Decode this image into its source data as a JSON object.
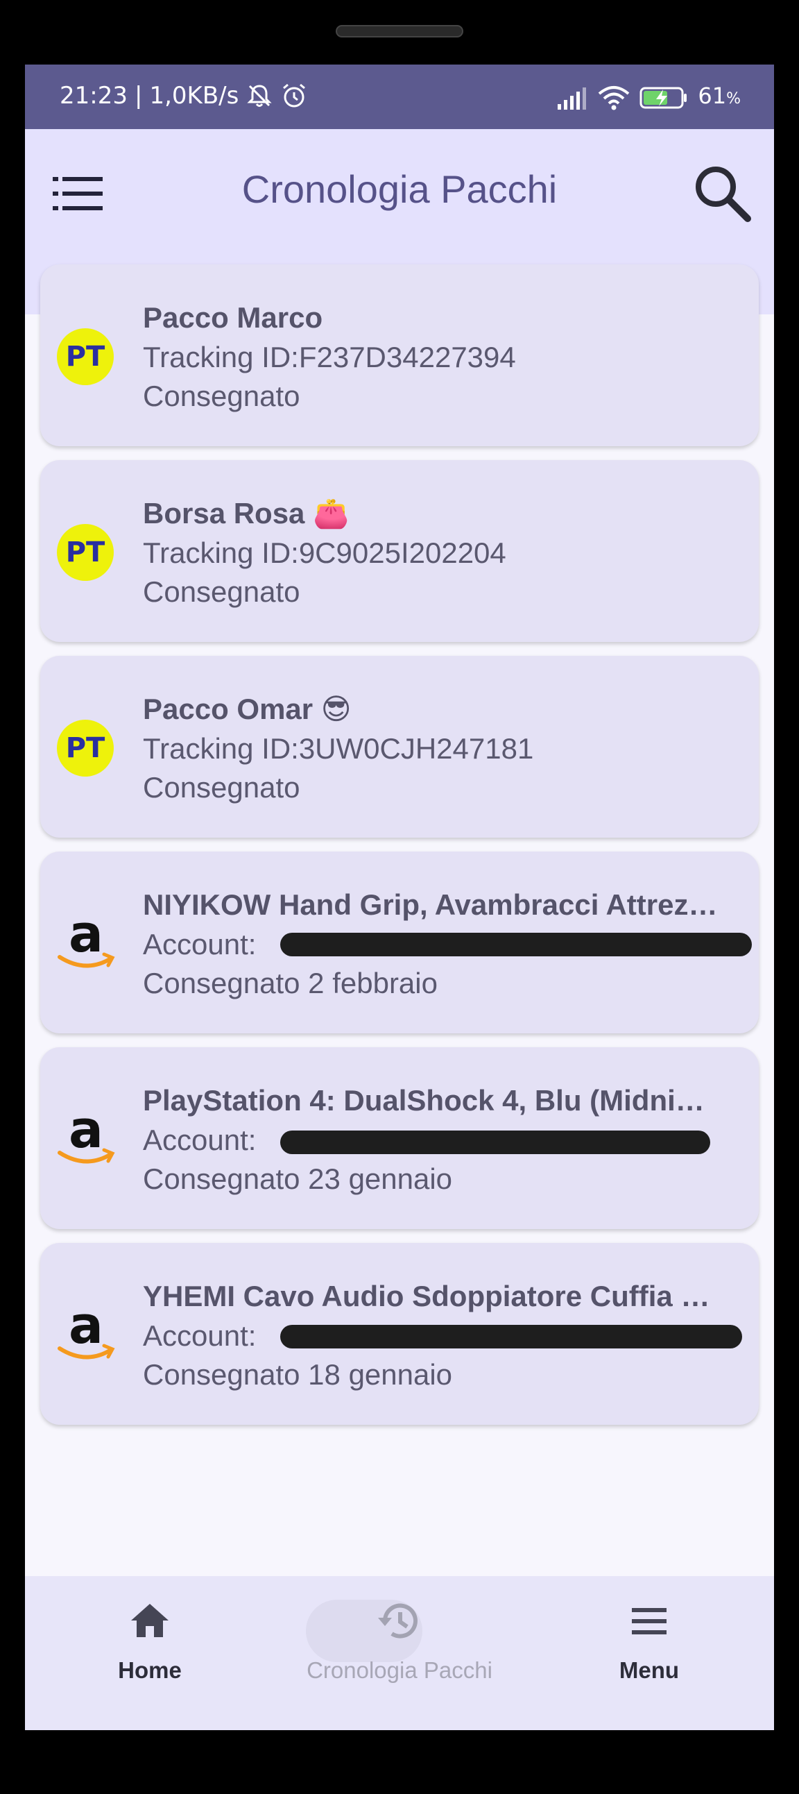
{
  "status_bar": {
    "time": "21:23",
    "separator": "|",
    "speed": "1,0KB/s",
    "battery": "61",
    "battery_unit": "%",
    "icons": [
      "mute-bell-icon",
      "alarm-icon",
      "signal-icon",
      "wifi-icon",
      "battery-charging-icon"
    ]
  },
  "app_bar": {
    "title": "Cronologia Pacchi",
    "menu_icon": "list-menu-icon",
    "search_icon": "search-icon"
  },
  "packages": [
    {
      "carrier": "PT",
      "name": "Pacco Marco",
      "detail": "Tracking ID:F237D34227394",
      "status": "Consegnato"
    },
    {
      "carrier": "PT",
      "name": "Borsa Rosa 👛",
      "detail": "Tracking ID:9C9025I202204",
      "status": "Consegnato"
    },
    {
      "carrier": "PT",
      "name": "Pacco Omar 😎",
      "detail": "Tracking ID:3UW0CJH247181",
      "status": "Consegnato"
    },
    {
      "carrier": "amazon",
      "name": "NIYIKOW Hand Grip, Avambracci Attrez…",
      "detail": "Account:",
      "status": "Consegnato 2 febbraio"
    },
    {
      "carrier": "amazon",
      "name": "PlayStation 4: DualShock 4, Blu (Midnig…",
      "detail": "Account:",
      "status": "Consegnato 23 gennaio"
    },
    {
      "carrier": "amazon",
      "name": "YHEMI Cavo Audio Sdoppiatore Cuffia e…",
      "detail": "Account:",
      "status": "Consegnato 18 gennaio"
    }
  ],
  "bottom_nav": {
    "items": [
      {
        "label": "Home",
        "icon": "home-icon",
        "active": false
      },
      {
        "label": "Cronologia Pacchi",
        "icon": "history-icon",
        "active": true
      },
      {
        "label": "Menu",
        "icon": "hamburger-icon",
        "active": false
      }
    ]
  },
  "colors": {
    "status_bar": "#5c5a8f",
    "app_bar": "#e4e1fd",
    "title": "#565289",
    "card": "#e4e1f5",
    "pt_logo": "#eef20b",
    "amazon_smile": "#f59a1e"
  }
}
